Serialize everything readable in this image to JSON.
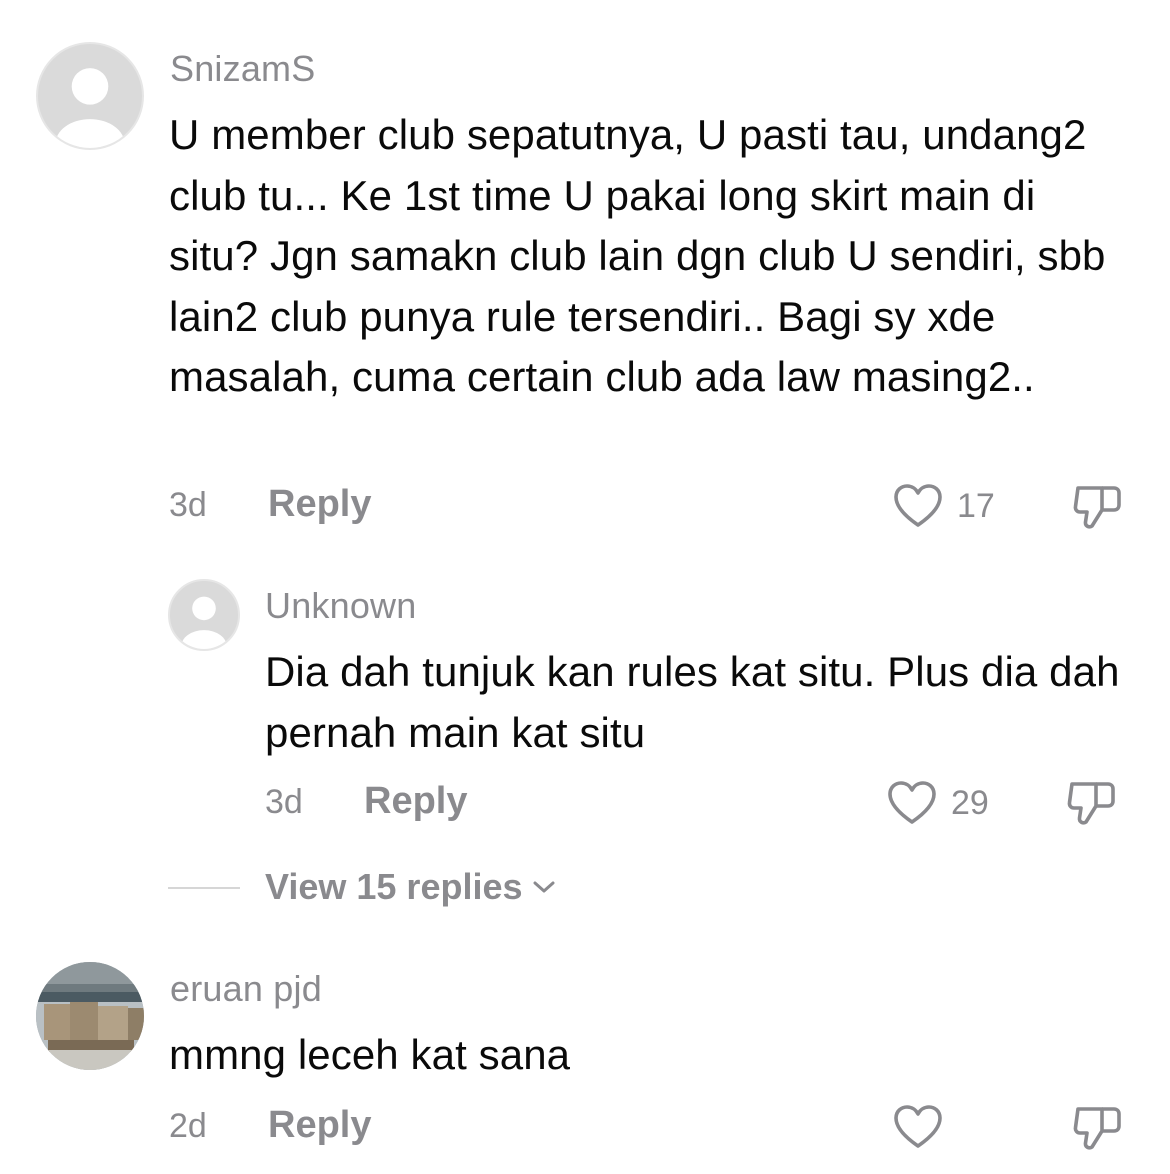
{
  "comments": [
    {
      "username": "SnizamS",
      "text": "U member club sepatutnya, U pasti tau, undang2 club tu... Ke 1st time U pakai long skirt main di situ? Jgn samakn club lain dgn club U sendiri, sbb lain2 club punya rule tersendiri.. Bagi sy xde masalah, cuma certain club ada law masing2..",
      "time": "3d",
      "reply_label": "Reply",
      "likes": "17",
      "avatar": "default-avatar-icon",
      "replies": [
        {
          "username": "Unknown",
          "text": "Dia dah tunjuk kan rules kat situ. Plus dia dah pernah main kat situ",
          "time": "3d",
          "reply_label": "Reply",
          "likes": "29",
          "avatar": "default-avatar-icon"
        }
      ],
      "view_replies_label": "View 15 replies"
    },
    {
      "username": "eruan pjd",
      "text": "mmng leceh kat sana",
      "time": "2d",
      "reply_label": "Reply",
      "likes": "",
      "avatar": "photo-avatar-warehouse"
    }
  ],
  "colors": {
    "text_primary": "#0a0a0a",
    "text_secondary": "#8a8a8e",
    "avatar_bg": "#dadada",
    "divider": "#d6d6d6"
  },
  "icons": {
    "like": "heart-outline-icon",
    "dislike": "thumbs-down-outline-icon",
    "expand": "chevron-down-icon"
  }
}
